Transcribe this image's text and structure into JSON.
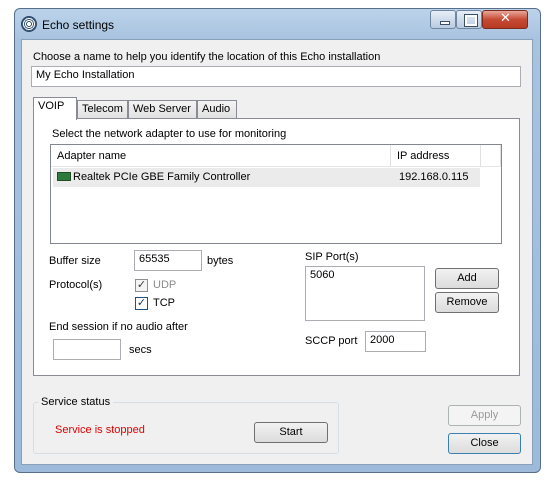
{
  "window": {
    "title": "Echo settings"
  },
  "location": {
    "label": "Choose a name to help you identify the location of this Echo installation",
    "value": "My Echo Installation"
  },
  "tabs": [
    "VOIP",
    "Telecom",
    "Web Server",
    "Audio"
  ],
  "voip": {
    "adapter_prompt": "Select the network adapter to use for monitoring",
    "columns": [
      "Adapter name",
      "IP address"
    ],
    "adapters": [
      {
        "name": "Realtek PCIe GBE Family Controller",
        "ip": "192.168.0.115",
        "icon": "network-card-icon"
      }
    ],
    "buffer_label": "Buffer size",
    "buffer_value": "65535",
    "buffer_unit": "bytes",
    "protocol_label": "Protocol(s)",
    "udp_label": "UDP",
    "udp_checked": true,
    "tcp_label": "TCP",
    "tcp_checked": true,
    "end_session_label": "End session if no audio after",
    "end_session_value": "",
    "end_session_unit": "secs",
    "sip_label": "SIP Port(s)",
    "sip_ports": [
      "5060"
    ],
    "add_label": "Add",
    "remove_label": "Remove",
    "sccp_label": "SCCP port",
    "sccp_value": "2000"
  },
  "service": {
    "group_label": "Service status",
    "status_text": "Service is stopped",
    "status_color": "#e00000",
    "start_label": "Start"
  },
  "buttons": {
    "apply": "Apply",
    "close": "Close"
  }
}
